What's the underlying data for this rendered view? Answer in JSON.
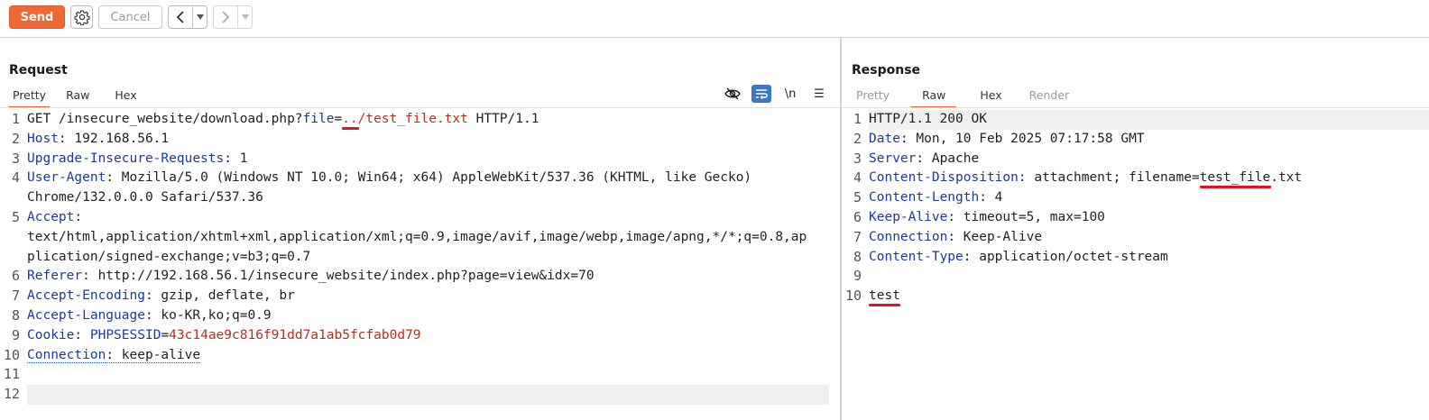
{
  "toolbar": {
    "send_label": "Send",
    "cancel_label": "Cancel",
    "prev_arrow": "<",
    "next_arrow": ">",
    "dropdown_glyph": "▾"
  },
  "request": {
    "title": "Request",
    "tabs": [
      "Pretty",
      "Raw",
      "Hex"
    ],
    "active_tab": "Pretty",
    "tools": {
      "newline_label": "\\n",
      "menu_glyph": "☰"
    },
    "lines": [
      {
        "n": "1",
        "parts": [
          {
            "t": "GET /insecure_website/download.php?",
            "c": ""
          },
          {
            "t": "file",
            "c": "key"
          },
          {
            "t": "=",
            "c": ""
          },
          {
            "t": "../test_file.txt",
            "c": "red"
          },
          {
            "t": " HTTP/1.1",
            "c": ""
          }
        ]
      },
      {
        "n": "2",
        "parts": [
          {
            "t": "Host",
            "c": "key"
          },
          {
            "t": ": 192.168.56.1",
            "c": ""
          }
        ]
      },
      {
        "n": "3",
        "parts": [
          {
            "t": "Upgrade-Insecure-Requests",
            "c": "key"
          },
          {
            "t": ": 1",
            "c": ""
          }
        ]
      },
      {
        "n": "4",
        "parts": [
          {
            "t": "User-Agent",
            "c": "key"
          },
          {
            "t": ": Mozilla/5.0 (Windows NT 10.0; Win64; x64) AppleWebKit/537.36 (KHTML, like Gecko)",
            "c": ""
          }
        ]
      },
      {
        "n": "",
        "parts": [
          {
            "t": "Chrome/132.0.0.0 Safari/537.36",
            "c": ""
          }
        ]
      },
      {
        "n": "5",
        "parts": [
          {
            "t": "Accept",
            "c": "key"
          },
          {
            "t": ":",
            "c": ""
          }
        ]
      },
      {
        "n": "",
        "parts": [
          {
            "t": "text/html,application/xhtml+xml,application/xml;q=0.9,image/avif,image/webp,image/apng,*/*;q=0.8,ap",
            "c": ""
          }
        ]
      },
      {
        "n": "",
        "parts": [
          {
            "t": "plication/signed-exchange;v=b3;q=0.7",
            "c": ""
          }
        ]
      },
      {
        "n": "6",
        "parts": [
          {
            "t": "Referer",
            "c": "key"
          },
          {
            "t": ": http://192.168.56.1/insecure_website/index.php?page=view&idx=70",
            "c": ""
          }
        ]
      },
      {
        "n": "7",
        "parts": [
          {
            "t": "Accept-Encoding",
            "c": "key"
          },
          {
            "t": ": gzip, deflate, br",
            "c": ""
          }
        ]
      },
      {
        "n": "8",
        "parts": [
          {
            "t": "Accept-Language",
            "c": "key"
          },
          {
            "t": ": ko-KR,ko;q=0.9",
            "c": ""
          }
        ]
      },
      {
        "n": "9",
        "parts": [
          {
            "t": "Cookie",
            "c": "key"
          },
          {
            "t": ": ",
            "c": ""
          },
          {
            "t": "PHPSESSID",
            "c": "key"
          },
          {
            "t": "=",
            "c": ""
          },
          {
            "t": "43c14ae9c816f91dd7a1ab5fcfab0d79",
            "c": "red"
          }
        ]
      },
      {
        "n": "10",
        "parts": [
          {
            "t": "Connection",
            "c": "key dotted"
          },
          {
            "t": ": keep-alive",
            "c": "dotted"
          }
        ]
      },
      {
        "n": "11",
        "parts": []
      },
      {
        "n": "12",
        "parts": [],
        "highlight": true
      }
    ]
  },
  "response": {
    "title": "Response",
    "tabs": [
      "Pretty",
      "Raw",
      "Hex",
      "Render"
    ],
    "active_tab": "Raw",
    "lines": [
      {
        "n": "1",
        "parts": [
          {
            "t": "HTTP/1.1 200 OK",
            "c": ""
          }
        ],
        "highlight": true
      },
      {
        "n": "2",
        "parts": [
          {
            "t": "Date",
            "c": "key"
          },
          {
            "t": ": Mon, 10 Feb 2025 07:17:58 GMT",
            "c": ""
          }
        ]
      },
      {
        "n": "3",
        "parts": [
          {
            "t": "Server",
            "c": "key"
          },
          {
            "t": ": Apache",
            "c": ""
          }
        ]
      },
      {
        "n": "4",
        "parts": [
          {
            "t": "Content-Disposition",
            "c": "key"
          },
          {
            "t": ": attachment; filename=test_file.txt",
            "c": ""
          }
        ]
      },
      {
        "n": "5",
        "parts": [
          {
            "t": "Content-Length",
            "c": "key"
          },
          {
            "t": ": 4",
            "c": ""
          }
        ]
      },
      {
        "n": "6",
        "parts": [
          {
            "t": "Keep-Alive",
            "c": "key"
          },
          {
            "t": ": timeout=5, max=100",
            "c": ""
          }
        ]
      },
      {
        "n": "7",
        "parts": [
          {
            "t": "Connection",
            "c": "key"
          },
          {
            "t": ": Keep-Alive",
            "c": ""
          }
        ]
      },
      {
        "n": "8",
        "parts": [
          {
            "t": "Content-Type",
            "c": "key"
          },
          {
            "t": ": application/octet-stream",
            "c": ""
          }
        ]
      },
      {
        "n": "9",
        "parts": []
      },
      {
        "n": "10",
        "parts": [
          {
            "t": "test",
            "c": ""
          }
        ]
      }
    ]
  },
  "colors": {
    "accent": "#ef6834",
    "header_key": "#1c3a9c",
    "value_red": "#b1311f",
    "annotation_red": "#e0121a"
  }
}
